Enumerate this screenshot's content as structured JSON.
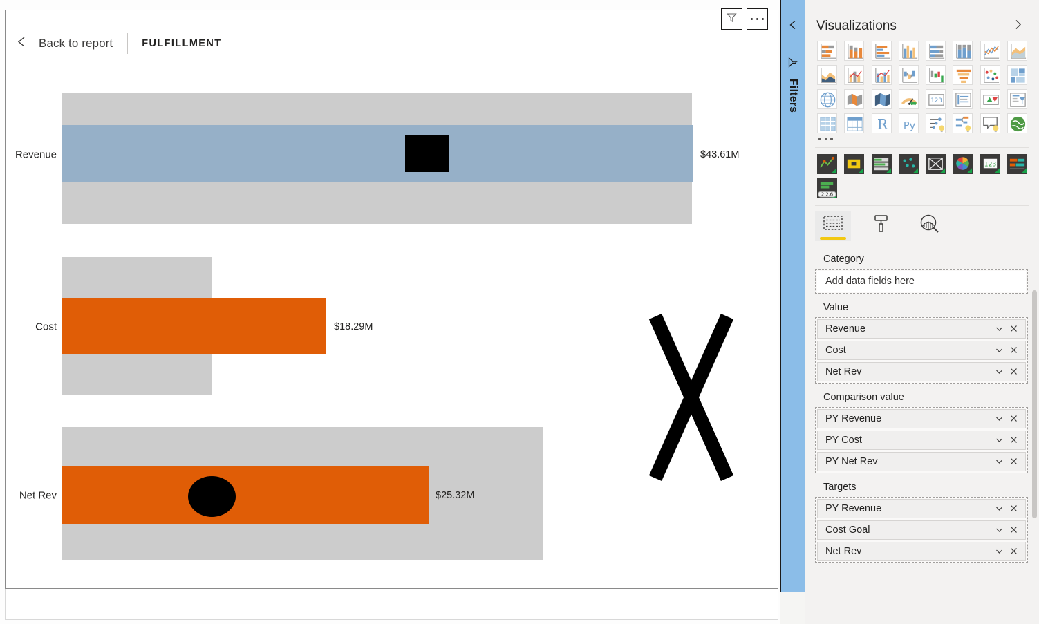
{
  "report": {
    "back_label": "Back to report",
    "page_title": "FULFILLMENT",
    "header_buttons": {
      "filter": "filter-icon",
      "more": "more-options-icon"
    }
  },
  "filters_rail": {
    "label": "Filters",
    "collapse_icon": "chevron-left-icon",
    "funnel_icon": "filter-funnel-icon"
  },
  "chart_data": {
    "type": "bar",
    "title": "FULFILLMENT",
    "subtype": "bullet",
    "categories": [
      "Revenue",
      "Cost",
      "Net Rev"
    ],
    "values": [
      43.61,
      18.29,
      25.32
    ],
    "value_labels": [
      "$43.61M",
      "$18.29M",
      "$25.32M"
    ],
    "series": [
      {
        "name": "Value",
        "values": [
          43.61,
          18.29,
          25.32
        ],
        "labels": [
          "$43.61M",
          "$18.29M",
          "$25.32M"
        ]
      },
      {
        "name": "Comparison value",
        "values": [
          43.52,
          10.35,
          31.25
        ],
        "labels": [
          "PY Revenue",
          "PY Cost",
          "PY Net Rev"
        ]
      },
      {
        "name": "Targets",
        "values": [
          23.67,
          null,
          10.35
        ],
        "labels": [
          "PY Revenue",
          "Cost Goal",
          "Net Rev"
        ]
      }
    ],
    "bars": [
      {
        "category": "Revenue",
        "value_label": "$43.61M",
        "bar_color": "#96b0c8",
        "band_color": "#cccccc",
        "band_left_pct": 0.0,
        "band_width_pct": 100.0,
        "bar_left_pct": 0.0,
        "bar_width_pct": 100.3,
        "marker": "square",
        "marker_color": "#000000",
        "marker_pos_pct": 54.4
      },
      {
        "category": "Cost",
        "value_label": "$18.29M",
        "bar_color": "#e05d06",
        "band_color": "#cccccc",
        "band_left_pct": 0.0,
        "band_width_pct": 23.7,
        "bar_left_pct": 0.0,
        "bar_width_pct": 41.8,
        "marker": "none",
        "marker_color": "#000000",
        "marker_pos_pct": 0
      },
      {
        "category": "Net Rev",
        "value_label": "$25.32M",
        "bar_color": "#e05d06",
        "band_color": "#cccccc",
        "band_left_pct": 0.0,
        "band_width_pct": 76.3,
        "bar_left_pct": 0.0,
        "bar_width_pct": 58.3,
        "marker": "circle",
        "marker_color": "#000000",
        "marker_pos_pct": 23.7
      }
    ],
    "annotation": {
      "shape": "x-mark",
      "color": "#000000"
    },
    "xlabel": "",
    "ylabel": "",
    "grid": false,
    "legend": "none"
  },
  "viz_pane": {
    "title": "Visualizations",
    "expand_icon": "chevron-right-icon",
    "more_visuals": "more-visuals-ellipsis",
    "gallery": [
      "stacked-bar-chart-icon",
      "stacked-column-chart-icon",
      "clustered-bar-chart-icon",
      "clustered-column-chart-icon",
      "100-stacked-bar-chart-icon",
      "100-stacked-column-chart-icon",
      "line-chart-icon",
      "area-chart-icon",
      "stacked-area-chart-icon",
      "line-and-stacked-column-icon",
      "line-and-clustered-column-icon",
      "ribbon-chart-icon",
      "waterfall-chart-icon",
      "funnel-chart-icon",
      "scatter-chart-icon",
      "treemap-icon",
      "map-icon",
      "filled-map-icon",
      "shape-map-icon",
      "gauge-icon",
      "card-icon",
      "multi-row-card-icon",
      "kpi-icon",
      "slicer-icon",
      "table-icon",
      "matrix-icon",
      "r-script-visual-icon",
      "python-visual-icon",
      "key-influencers-icon",
      "decomposition-tree-icon",
      "qna-visual-icon",
      "arcgis-maps-icon"
    ],
    "custom_visuals": [
      "custom-line-visual-icon",
      "custom-card-visual-icon",
      "custom-bullet-chart-icon",
      "custom-scatter-visual-icon",
      "custom-image-visual-icon",
      "custom-color-wheel-icon",
      "custom-number-visual-icon",
      "custom-gantt-icon",
      "custom-bullet-chart-2.2.6-icon"
    ],
    "custom_visual_version": "2.2.6",
    "tabs": [
      {
        "name": "fields",
        "icon": "fields-pane-icon",
        "active": true
      },
      {
        "name": "format",
        "icon": "paint-roller-icon",
        "active": false
      },
      {
        "name": "analytics",
        "icon": "analytics-magnifier-icon",
        "active": false
      }
    ],
    "wells": [
      {
        "title": "Category",
        "placeholder": "Add data fields here",
        "fields": []
      },
      {
        "title": "Value",
        "placeholder": "",
        "fields": [
          "Revenue",
          "Cost",
          "Net Rev"
        ]
      },
      {
        "title": "Comparison value",
        "placeholder": "",
        "fields": [
          "PY Revenue",
          "PY Cost",
          "PY Net Rev"
        ]
      },
      {
        "title": "Targets",
        "placeholder": "",
        "fields": [
          "PY Revenue",
          "Cost Goal",
          "Net Rev"
        ]
      }
    ],
    "chip_icons": {
      "dropdown": "chevron-down-icon",
      "remove": "close-x-icon"
    }
  },
  "colors": {
    "accent_orange": "#e05d06",
    "bar_blue": "#96b0c8",
    "band_gray": "#cccccc",
    "filters_blue": "#8bbde8",
    "pane_bg": "#f3f2f1",
    "tab_underline": "#f2c811"
  }
}
